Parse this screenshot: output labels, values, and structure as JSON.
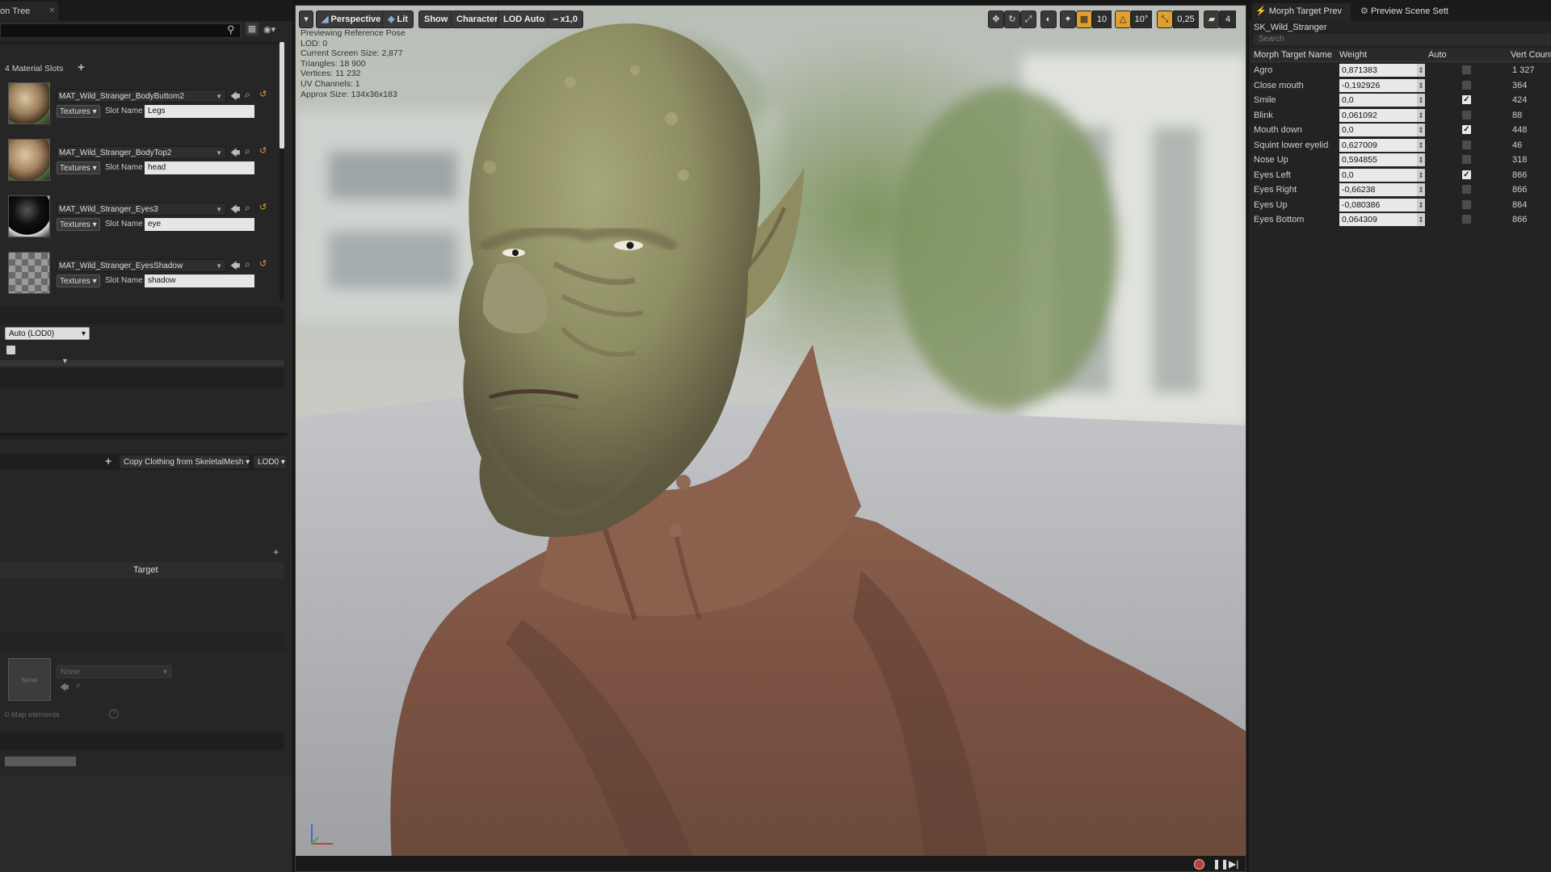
{
  "left_panel": {
    "tab_label": "on Tree",
    "material_slots_title": "4 Material Slots",
    "slots": [
      {
        "material": "MAT_Wild_Stranger_BodyButtom2",
        "textures_label": "Textures",
        "slot_name_label": "Slot Name",
        "slot_name": "Legs",
        "thumb": "sphere-body"
      },
      {
        "material": "MAT_Wild_Stranger_BodyTop2",
        "textures_label": "Textures",
        "slot_name_label": "Slot Name",
        "slot_name": "head",
        "thumb": "sphere-body"
      },
      {
        "material": "MAT_Wild_Stranger_Eyes3",
        "textures_label": "Textures",
        "slot_name_label": "Slot Name",
        "slot_name": "eye",
        "thumb": "sphere-dark"
      },
      {
        "material": "MAT_Wild_Stranger_EyesShadow",
        "textures_label": "Textures",
        "slot_name_label": "Slot Name",
        "slot_name": "shadow",
        "thumb": "sphere-checker"
      }
    ],
    "lod_select": "Auto (LOD0)",
    "copy_clothing_button": "Copy Clothing from SkeletalMesh",
    "lod_dropdown": "LOD0",
    "target_header": "Target",
    "asset_none_thumb": "None",
    "asset_none_select": "None",
    "map_elements": "0 Map elements"
  },
  "viewport": {
    "perspective": "Perspective",
    "lit": "Lit",
    "show": "Show",
    "character": "Character",
    "lod_auto": "LOD Auto",
    "speed": "x1,0",
    "grid_snap": "10",
    "rotation_snap": "10°",
    "scale_snap": "0,25",
    "camera_speed": "4",
    "info_lines": [
      "Previewing Reference Pose",
      "LOD: 0",
      "Current Screen Size: 2,877",
      "Triangles: 18 900",
      "Vertices: 11 232",
      "UV Channels: 1",
      "Approx Size: 134x36x183"
    ]
  },
  "right_panel": {
    "tabs": [
      "Morph Target Prev",
      "Preview Scene Sett"
    ],
    "asset_name": "SK_Wild_Stranger",
    "search_placeholder": "Search",
    "columns": [
      "Morph Target Name",
      "Weight",
      "Auto",
      "Vert Count"
    ],
    "morphs": [
      {
        "name": "Agro",
        "weight": "0,871383",
        "auto": false,
        "verts": "1 327"
      },
      {
        "name": "Close mouth",
        "weight": "-0,192926",
        "auto": false,
        "verts": "364"
      },
      {
        "name": "Smile",
        "weight": "0,0",
        "auto": true,
        "verts": "424"
      },
      {
        "name": "Blink",
        "weight": "0,061092",
        "auto": false,
        "verts": "88"
      },
      {
        "name": "Mouth down",
        "weight": "0,0",
        "auto": true,
        "verts": "448"
      },
      {
        "name": "Squint lower eyelid",
        "weight": "0,627009",
        "auto": false,
        "verts": "46"
      },
      {
        "name": "Nose Up",
        "weight": "0,594855",
        "auto": false,
        "verts": "318"
      },
      {
        "name": "Eyes Left",
        "weight": "0,0",
        "auto": true,
        "verts": "866"
      },
      {
        "name": "Eyes Right",
        "weight": "-0,66238",
        "auto": false,
        "verts": "866"
      },
      {
        "name": "Eyes Up",
        "weight": "-0,080386",
        "auto": false,
        "verts": "864"
      },
      {
        "name": "Eyes Bottom",
        "weight": "0,064309",
        "auto": false,
        "verts": "866"
      }
    ]
  },
  "colors": {
    "panel_bg": "#262626",
    "accent_orange": "#e0a030",
    "viewport_floor": "#a9a9a9",
    "skin_green": "#8f936a",
    "skin_brown": "#7d5446"
  }
}
